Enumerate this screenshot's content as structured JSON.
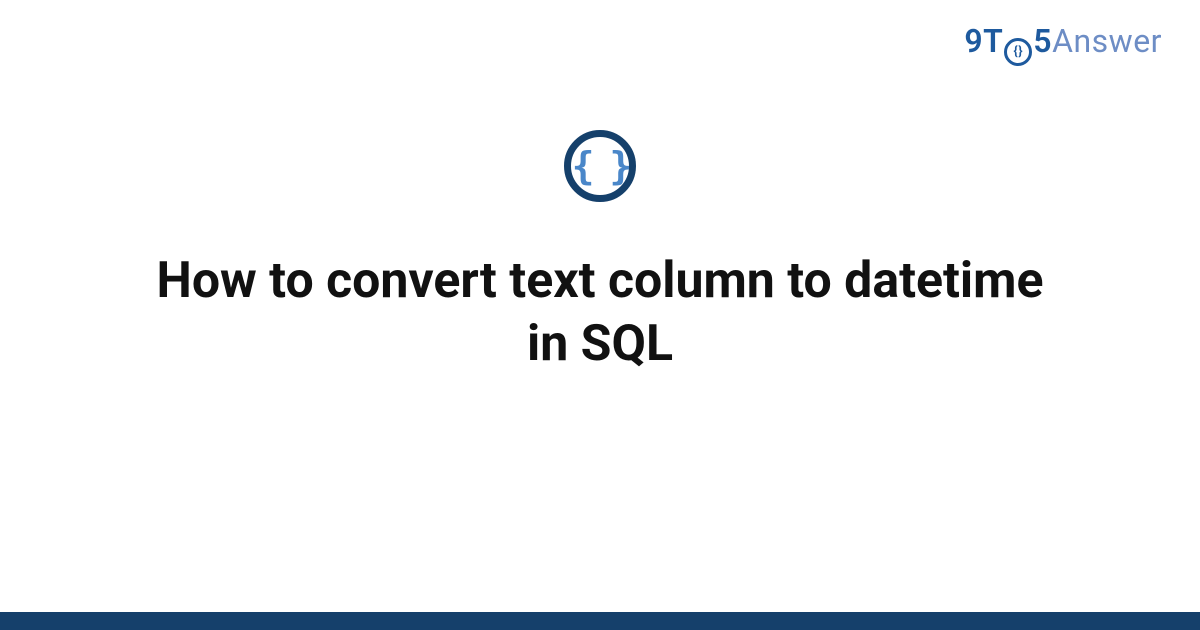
{
  "brand": {
    "part1": "9T",
    "circle_glyph": "{}",
    "part2": "5",
    "part3": "Answer"
  },
  "badge": {
    "glyph": "{ }",
    "name": "code-braces-icon"
  },
  "title": "How to convert text column to datetime in SQL",
  "colors": {
    "brand_dark": "#15406b",
    "brand_mid": "#1e5a9e",
    "brand_light": "#6d8dc5",
    "brace_blue": "#4a87c9"
  }
}
